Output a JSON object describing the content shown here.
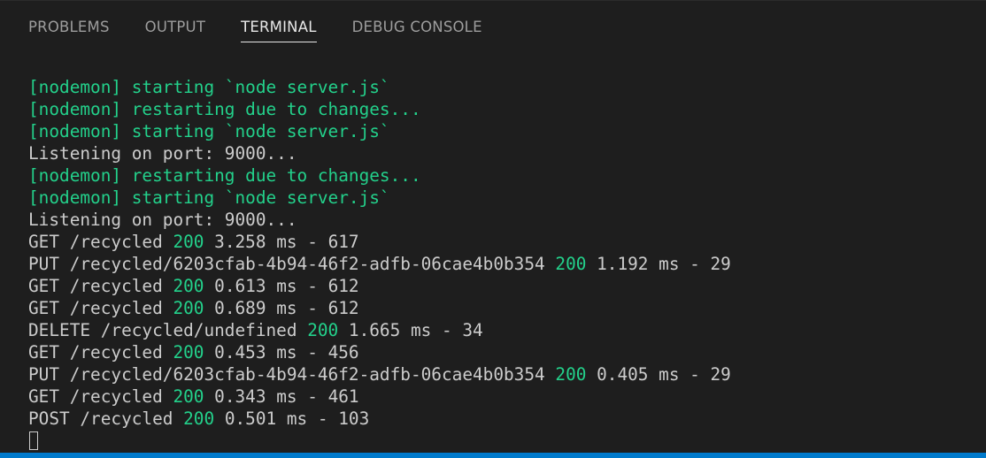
{
  "tabs": [
    {
      "label": "PROBLEMS",
      "active": false
    },
    {
      "label": "OUTPUT",
      "active": false
    },
    {
      "label": "TERMINAL",
      "active": true
    },
    {
      "label": "DEBUG CONSOLE",
      "active": false
    }
  ],
  "terminal": {
    "lines": [
      {
        "segments": [
          {
            "text": "[nodemon] starting `node server.js`",
            "color": "green"
          }
        ]
      },
      {
        "segments": [
          {
            "text": "[nodemon] restarting due to changes...",
            "color": "green"
          }
        ]
      },
      {
        "segments": [
          {
            "text": "[nodemon] starting `node server.js`",
            "color": "green"
          }
        ]
      },
      {
        "segments": [
          {
            "text": "Listening on port: 9000...",
            "color": "default"
          }
        ]
      },
      {
        "segments": [
          {
            "text": "[nodemon] restarting due to changes...",
            "color": "green"
          }
        ]
      },
      {
        "segments": [
          {
            "text": "[nodemon] starting `node server.js`",
            "color": "green"
          }
        ]
      },
      {
        "segments": [
          {
            "text": "Listening on port: 9000...",
            "color": "default"
          }
        ]
      },
      {
        "segments": [
          {
            "text": "GET /recycled ",
            "color": "default"
          },
          {
            "text": "200",
            "color": "green"
          },
          {
            "text": " 3.258 ms - 617",
            "color": "default"
          }
        ]
      },
      {
        "segments": [
          {
            "text": "PUT /recycled/6203cfab-4b94-46f2-adfb-06cae4b0b354 ",
            "color": "default"
          },
          {
            "text": "200",
            "color": "green"
          },
          {
            "text": " 1.192 ms - 29",
            "color": "default"
          }
        ]
      },
      {
        "segments": [
          {
            "text": "GET /recycled ",
            "color": "default"
          },
          {
            "text": "200",
            "color": "green"
          },
          {
            "text": " 0.613 ms - 612",
            "color": "default"
          }
        ]
      },
      {
        "segments": [
          {
            "text": "GET /recycled ",
            "color": "default"
          },
          {
            "text": "200",
            "color": "green"
          },
          {
            "text": " 0.689 ms - 612",
            "color": "default"
          }
        ]
      },
      {
        "segments": [
          {
            "text": "DELETE /recycled/undefined ",
            "color": "default"
          },
          {
            "text": "200",
            "color": "green"
          },
          {
            "text": " 1.665 ms - 34",
            "color": "default"
          }
        ]
      },
      {
        "segments": [
          {
            "text": "GET /recycled ",
            "color": "default"
          },
          {
            "text": "200",
            "color": "green"
          },
          {
            "text": " 0.453 ms - 456",
            "color": "default"
          }
        ]
      },
      {
        "segments": [
          {
            "text": "PUT /recycled/6203cfab-4b94-46f2-adfb-06cae4b0b354 ",
            "color": "default"
          },
          {
            "text": "200",
            "color": "green"
          },
          {
            "text": " 0.405 ms - 29",
            "color": "default"
          }
        ]
      },
      {
        "segments": [
          {
            "text": "GET /recycled ",
            "color": "default"
          },
          {
            "text": "200",
            "color": "green"
          },
          {
            "text": " 0.343 ms - 461",
            "color": "default"
          }
        ]
      },
      {
        "segments": [
          {
            "text": "POST /recycled ",
            "color": "default"
          },
          {
            "text": "200",
            "color": "green"
          },
          {
            "text": " 0.501 ms - 103",
            "color": "default"
          }
        ]
      }
    ]
  },
  "colors": {
    "background": "#1e1e1e",
    "text": "#cccccc",
    "green": "#23d18b",
    "tab_inactive": "#9d9d9d",
    "tab_active": "#e7e7e7",
    "statusbar": "#007acc"
  }
}
